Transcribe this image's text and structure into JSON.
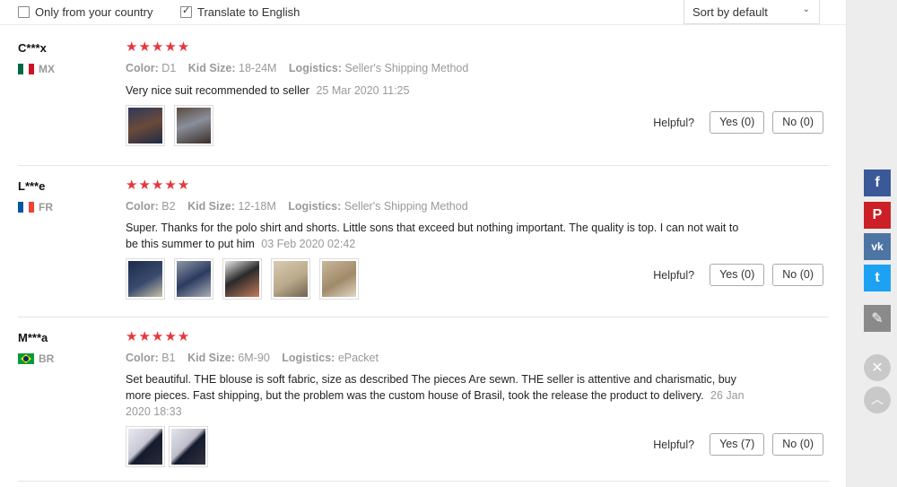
{
  "filters": {
    "only_country": "Only from your country",
    "translate": "Translate to English",
    "sort_value": "Sort by default"
  },
  "reviews": [
    {
      "user": "C***x",
      "country": "MX",
      "stars": "★★★★★",
      "color_label": "Color:",
      "color_value": "D1",
      "size_label": "Kid Size:",
      "size_value": "18-24M",
      "logistics_label": "Logistics:",
      "logistics_value": "Seller's Shipping Method",
      "text": "Very nice suit recommended to seller",
      "date": "25 Mar 2020 11:25",
      "helpful_label": "Helpful?",
      "yes": "Yes (0)",
      "no": "No (0)"
    },
    {
      "user": "L***e",
      "country": "FR",
      "stars": "★★★★★",
      "color_label": "Color:",
      "color_value": "B2",
      "size_label": "Kid Size:",
      "size_value": "12-18M",
      "logistics_label": "Logistics:",
      "logistics_value": "Seller's Shipping Method",
      "text": "Super. Thanks for the polo shirt and shorts. Little sons that exceed but nothing important. The quality is top. I can not wait to be this summer to put him",
      "date": "03 Feb 2020 02:42",
      "helpful_label": "Helpful?",
      "yes": "Yes (0)",
      "no": "No (0)"
    },
    {
      "user": "M***a",
      "country": "BR",
      "stars": "★★★★★",
      "color_label": "Color:",
      "color_value": "B1",
      "size_label": "Kid Size:",
      "size_value": "6M-90",
      "logistics_label": "Logistics:",
      "logistics_value": "ePacket",
      "text": "Set beautiful. THE blouse is soft fabric, size as described The pieces Are sewn. THE seller is attentive and charismatic, buy more pieces. Fast shipping, but the problem was the custom house of Brasil, took the release the product to delivery.",
      "date": "26 Jan 2020 18:33",
      "helpful_label": "Helpful?",
      "yes": "Yes (7)",
      "no": "No (0)"
    }
  ],
  "social": {
    "facebook": "f",
    "pinterest": "P",
    "vk": "vk",
    "twitter": "t",
    "edit": "✎",
    "close": "✕",
    "up": "︿"
  },
  "colors": {
    "star": "#e6373d",
    "facebook": "#3b5998",
    "pinterest": "#cb2027",
    "vk": "#4c75a3",
    "twitter": "#1da1f2",
    "edit": "#8a8a8a"
  }
}
